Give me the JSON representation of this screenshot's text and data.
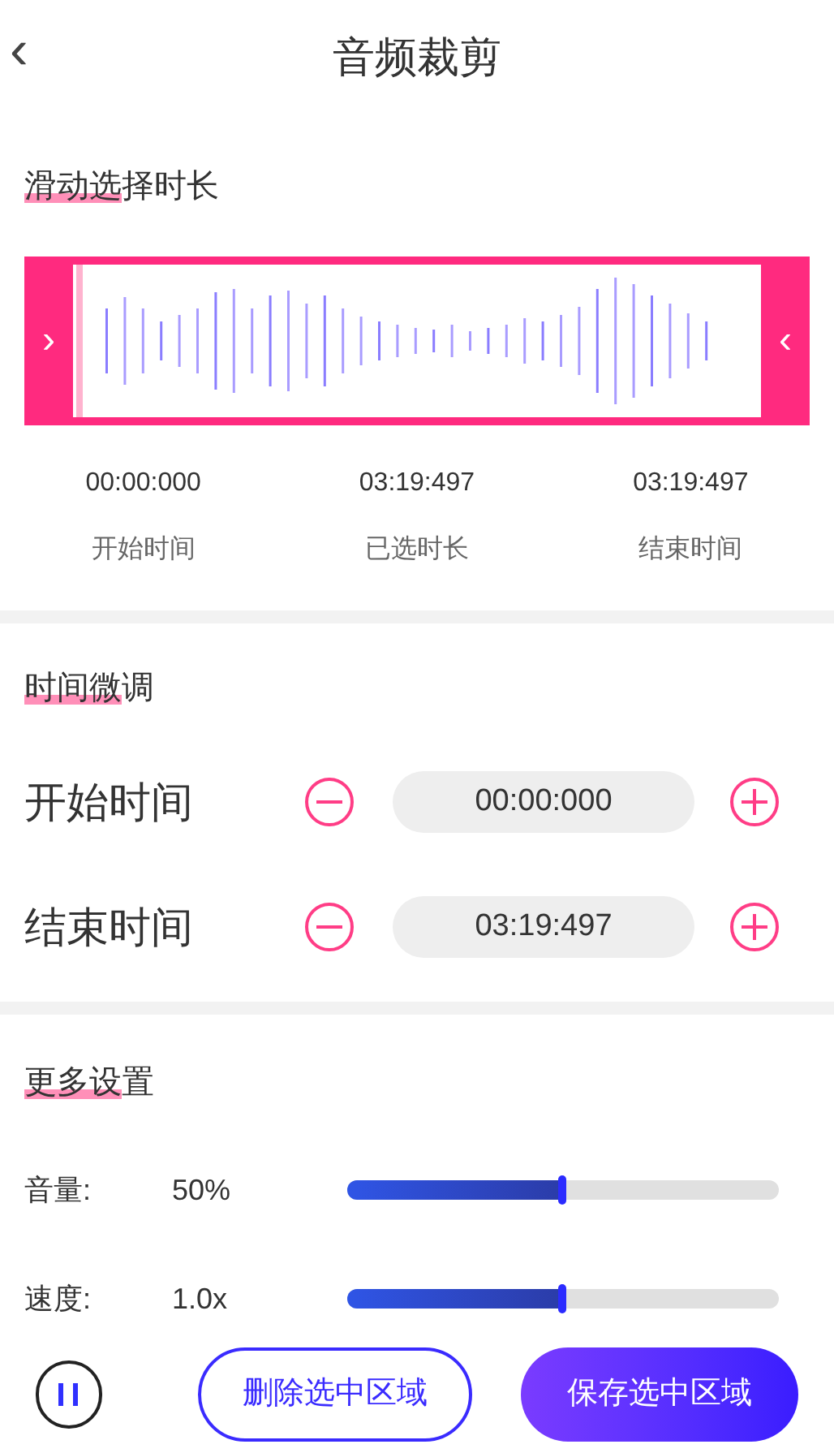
{
  "header": {
    "back_icon": "‹",
    "title": "音频裁剪"
  },
  "trim_section": {
    "title": "滑动选择时长",
    "left_handle": "›",
    "right_handle": "‹",
    "readouts": [
      {
        "value": "00:00:000",
        "label": "开始时间"
      },
      {
        "value": "03:19:497",
        "label": "已选时长"
      },
      {
        "value": "03:19:497",
        "label": "结束时间"
      }
    ]
  },
  "fine_tune": {
    "title": "时间微调",
    "rows": [
      {
        "label": "开始时间",
        "value": "00:00:000"
      },
      {
        "label": "结束时间",
        "value": "03:19:497"
      }
    ]
  },
  "more_settings": {
    "title": "更多设置",
    "sliders": [
      {
        "label": "音量:",
        "reading": "50%",
        "level": 0.5
      },
      {
        "label": "速度:",
        "reading": "1.0x",
        "level": 0.5
      }
    ]
  },
  "footer": {
    "delete_button": "删除选中区域",
    "save_button": "保存选中区域"
  }
}
